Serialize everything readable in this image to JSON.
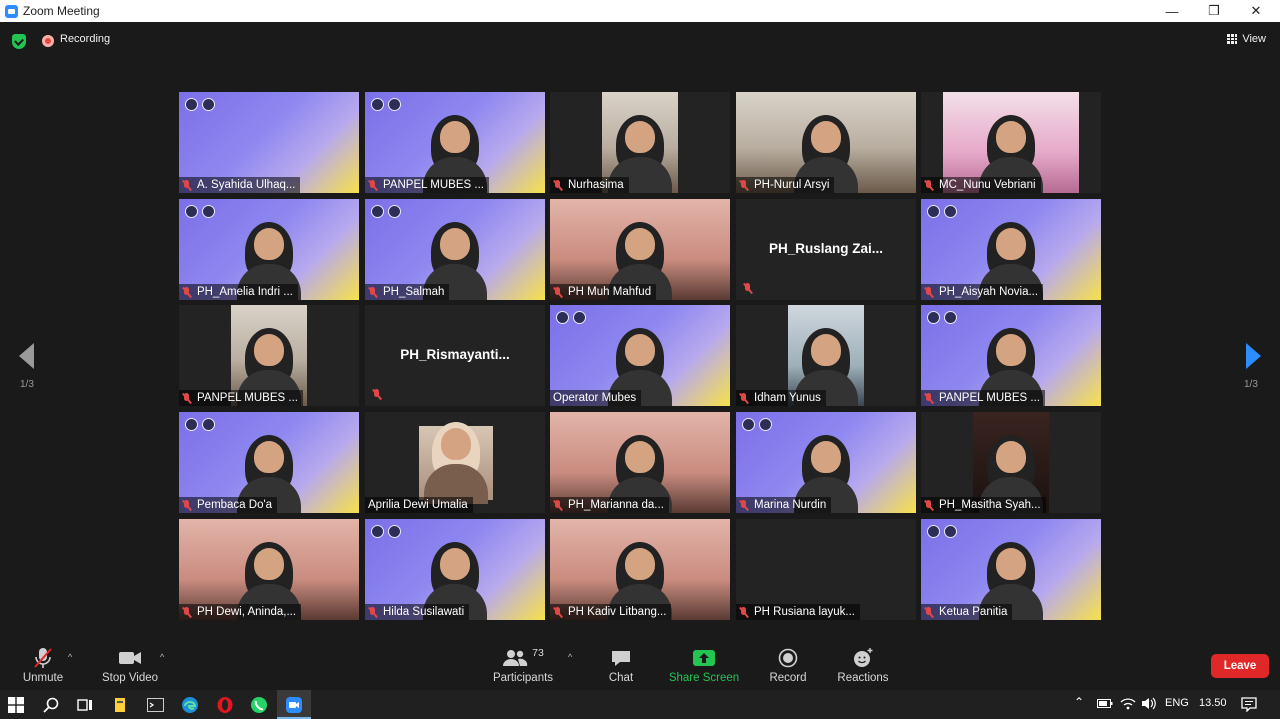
{
  "window": {
    "title": "Zoom Meeting",
    "minimize": "—",
    "restore": "❐",
    "close": "✕"
  },
  "meeting_bar": {
    "recording_label": "Recording",
    "view_label": "View"
  },
  "pagination": {
    "left_label": "1/3",
    "right_label": "1/3"
  },
  "tiles": [
    {
      "name": "A. Syahida Ulhaq...",
      "muted": true,
      "style": "banner"
    },
    {
      "name": "PANPEL MUBES ...",
      "muted": true,
      "style": "banner-person"
    },
    {
      "name": "Nurhasima",
      "muted": true,
      "style": "cam"
    },
    {
      "name": "PH-Nurul Arsyi",
      "muted": true,
      "style": "cam-wide"
    },
    {
      "name": "MC_Nunu Vebriani",
      "muted": true,
      "style": "cam-pink"
    },
    {
      "name": "PH_Amelia Indri ...",
      "muted": true,
      "style": "banner-person"
    },
    {
      "name": "PH_Salmah",
      "muted": true,
      "style": "banner-person"
    },
    {
      "name": "PH Muh Mahfud",
      "muted": true,
      "style": "cam-warm"
    },
    {
      "name": "PH_Ruslang  Zai...",
      "muted": true,
      "style": "no-video"
    },
    {
      "name": "PH_Aisyah Novia...",
      "muted": true,
      "style": "banner-person"
    },
    {
      "name": "PANPEL MUBES ...",
      "muted": true,
      "style": "cam"
    },
    {
      "name": "PH_Rismayanti...",
      "muted": true,
      "style": "no-video"
    },
    {
      "name": "Operator Mubes",
      "muted": false,
      "style": "banner-person",
      "active": true
    },
    {
      "name": "Idham Yunus",
      "muted": true,
      "style": "cam-cool"
    },
    {
      "name": "PANPEL MUBES ...",
      "muted": true,
      "style": "banner-person"
    },
    {
      "name": "Pembaca Do'a",
      "muted": true,
      "style": "banner-person"
    },
    {
      "name": "Aprilia Dewi Umalia",
      "muted": false,
      "style": "photo"
    },
    {
      "name": "PH_Marianna da...",
      "muted": true,
      "style": "cam-warm"
    },
    {
      "name": "Marina Nurdin",
      "muted": true,
      "style": "banner-person"
    },
    {
      "name": "PH_Masitha Syah...",
      "muted": true,
      "style": "cam-dark"
    },
    {
      "name": "PH Dewi, Aninda,...",
      "muted": true,
      "style": "cam-warm"
    },
    {
      "name": "Hilda Susilawati",
      "muted": true,
      "style": "banner-person"
    },
    {
      "name": "PH Kadiv Litbang...",
      "muted": true,
      "style": "cam-warm"
    },
    {
      "name": "PH Rusiana layuk...",
      "muted": true,
      "style": "blank"
    },
    {
      "name": "Ketua Panitia",
      "muted": true,
      "style": "banner-person"
    }
  ],
  "toolbar": {
    "unmute": "Unmute",
    "stop_video": "Stop Video",
    "participants": "Participants",
    "participants_count": "73",
    "chat": "Chat",
    "share_screen": "Share Screen",
    "record": "Record",
    "reactions": "Reactions",
    "leave": "Leave"
  },
  "taskbar": {
    "language": "ENG",
    "time": "13.50"
  },
  "colors": {
    "accent_green": "#23c552",
    "share_green": "#23c552",
    "leave_red": "#e02828",
    "active_border": "#d6e644",
    "nav_blue": "#2d8cff"
  }
}
